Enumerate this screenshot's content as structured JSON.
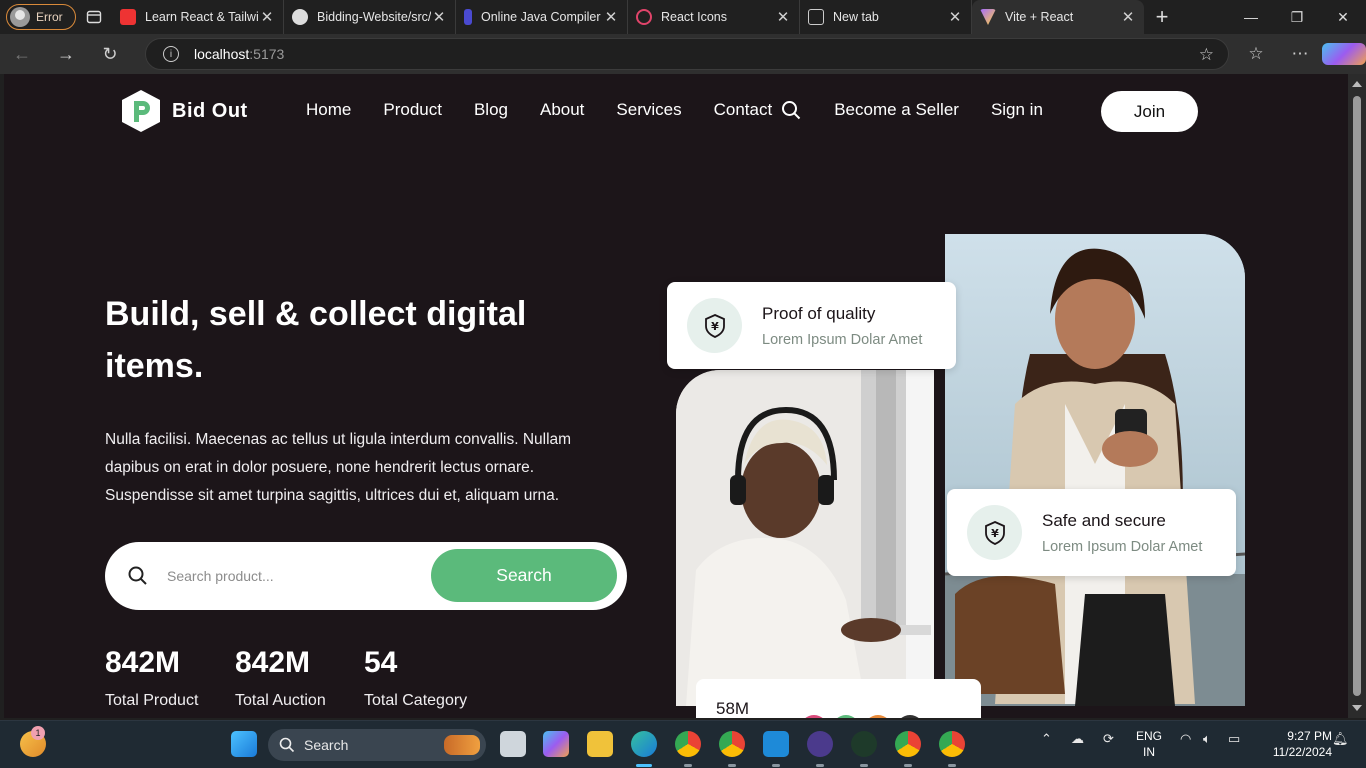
{
  "browser": {
    "profile_label": "Error",
    "tabs": [
      {
        "title": "Learn React & Tailwind",
        "icon": "youtube-icon",
        "color": "#e33"
      },
      {
        "title": "Bidding-Website/src/",
        "icon": "github-icon",
        "color": "#ddd"
      },
      {
        "title": "Online Java Compiler",
        "icon": "compiler-icon",
        "color": "#4a4ad0"
      },
      {
        "title": "React Icons",
        "icon": "react-icon",
        "color": "#e0446a"
      },
      {
        "title": "New tab",
        "icon": "newtab-icon",
        "color": "#ccc"
      },
      {
        "title": "Vite + React",
        "icon": "vite-icon",
        "color": "#a56cff"
      }
    ],
    "url_host": "localhost",
    "url_port": ":5173"
  },
  "site": {
    "brand": "Bid Out",
    "menu": [
      "Home",
      "Product",
      "Blog",
      "About",
      "Services",
      "Contact"
    ],
    "become_seller": "Become a Seller",
    "sign_in": "Sign in",
    "join": "Join",
    "hero_title": "Build, sell & collect digital items.",
    "hero_text": "Nulla facilisi. Maecenas ac tellus ut ligula interdum convallis. Nullam dapibus on erat in dolor posuere, none hendrerit lectus ornare. Suspendisse sit amet turpina sagittis, ultrices dui et, aliquam urna.",
    "search_placeholder": "Search product...",
    "search_button": "Search",
    "stats": [
      {
        "value": "842M",
        "label": "Total Product"
      },
      {
        "value": "842M",
        "label": "Total Auction"
      },
      {
        "value": "54",
        "label": "Total Category"
      }
    ],
    "cards": [
      {
        "title": "Proof of quality",
        "subtitle": "Lorem Ipsum Dolar Amet"
      },
      {
        "title": "Safe and secure",
        "subtitle": "Lorem Ipsum Dolar Amet"
      }
    ],
    "partial_card_value": "58M",
    "accent_color": "#5bba7b",
    "background_color": "#1c1519"
  },
  "taskbar": {
    "search_label": "Search",
    "notification_count": "1",
    "lang_line1": "ENG",
    "lang_line2": "IN",
    "time": "9:27 PM",
    "date": "11/22/2024"
  }
}
